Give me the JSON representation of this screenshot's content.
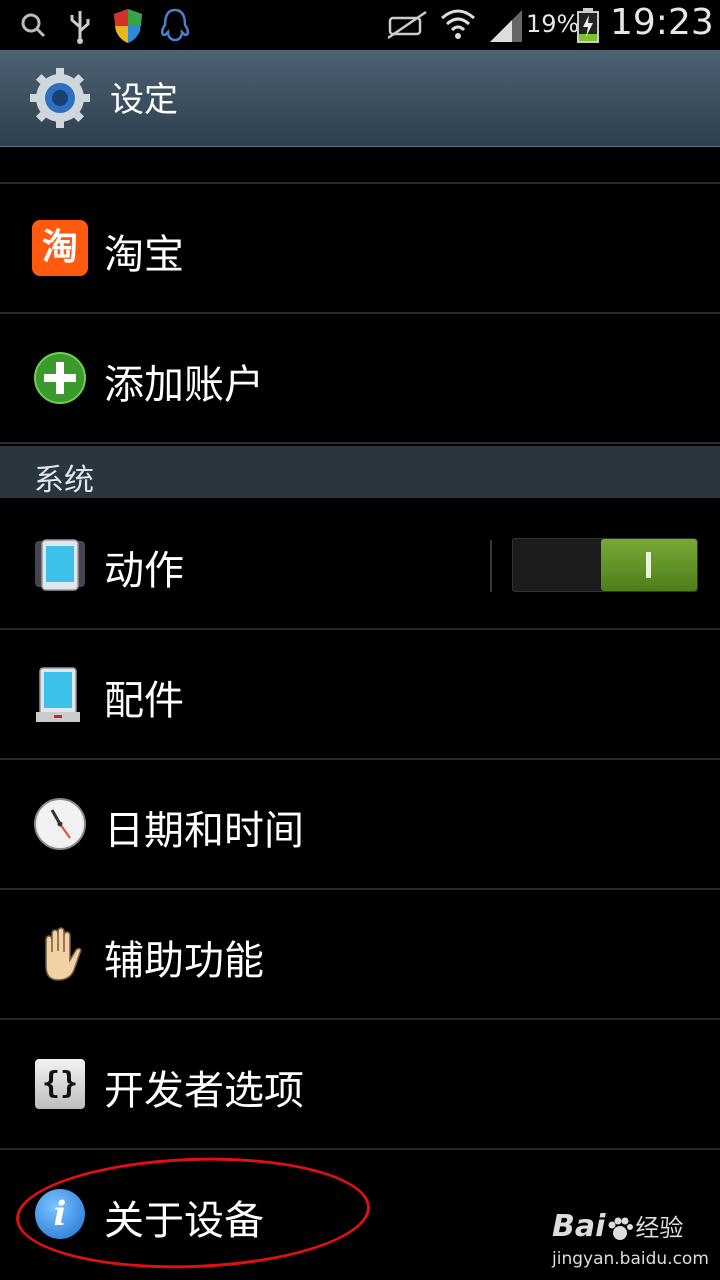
{
  "status_bar": {
    "battery_percent": "19%",
    "time": "19:23",
    "icons": [
      "search-icon",
      "usb-icon",
      "shield-icon",
      "qq-icon",
      "mute-icon",
      "wifi-icon",
      "signal-icon",
      "battery-icon"
    ]
  },
  "header": {
    "title": "设定",
    "icon": "settings-gear-icon"
  },
  "accounts": [
    {
      "label": "淘宝",
      "icon": "taobao-icon",
      "icon_text": "淘"
    },
    {
      "label": "添加账户",
      "icon": "add-account-icon"
    }
  ],
  "section": {
    "label": "系统"
  },
  "system_items": [
    {
      "label": "动作",
      "icon": "motion-phone-icon",
      "toggle": true
    },
    {
      "label": "配件",
      "icon": "accessory-dock-icon"
    },
    {
      "label": "日期和时间",
      "icon": "clock-icon"
    },
    {
      "label": "辅助功能",
      "icon": "hand-icon"
    },
    {
      "label": "开发者选项",
      "icon": "developer-braces-icon",
      "icon_text": "{}"
    },
    {
      "label": "关于设备",
      "icon": "info-icon",
      "icon_text": "i"
    }
  ],
  "watermark": {
    "brand_a": "Bai",
    "brand_b": "经验",
    "url": "jingyan.baidu.com"
  },
  "colors": {
    "accent_green": "#5f9a1f",
    "highlight_red": "#e01010",
    "header_bg": "#3d5161"
  }
}
